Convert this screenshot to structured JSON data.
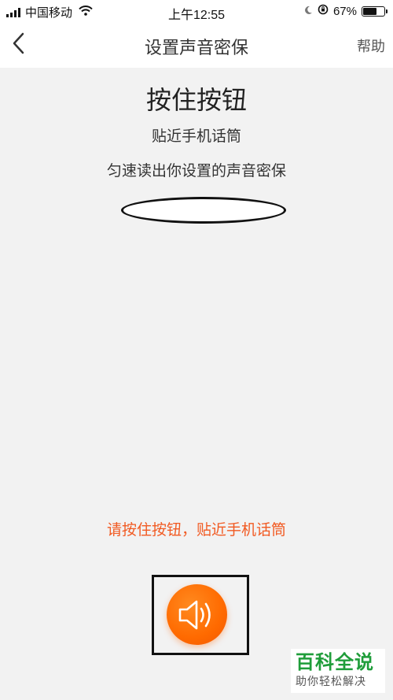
{
  "status_bar": {
    "carrier": "中国移动",
    "time": "上午12:55",
    "battery_percent_label": "67%",
    "battery_level": 0.67
  },
  "nav": {
    "title": "设置声音密保",
    "help_label": "帮助",
    "back_icon": "chevron-left-icon"
  },
  "content": {
    "heading": "按住按钮",
    "instruction_1": "贴近手机话筒",
    "instruction_2": "匀速读出你设置的声音密保",
    "hint": "请按住按钮，贴近手机话筒"
  },
  "speak_button": {
    "icon": "speaker-icon",
    "color": "#ff6a00"
  },
  "watermark": {
    "title": "百科全说",
    "subtitle": "助你轻松解决"
  },
  "colors": {
    "accent": "#f15a22",
    "background": "#f2f2f2",
    "brand_green": "#1f9d3a"
  }
}
